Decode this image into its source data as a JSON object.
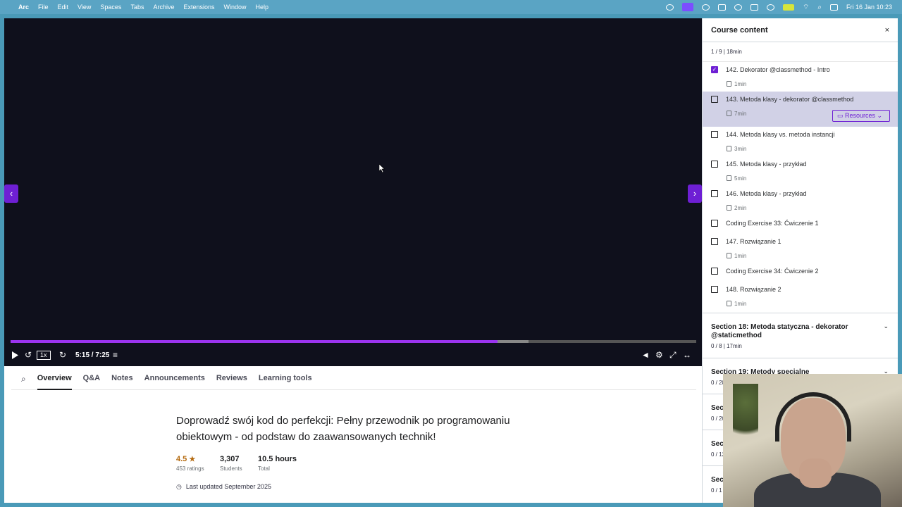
{
  "menubar": {
    "items": [
      "Arc",
      "File",
      "Edit",
      "View",
      "Spaces",
      "Tabs",
      "Archive",
      "Extensions",
      "Window",
      "Help"
    ],
    "clock": "Fri 16 Jan  10:23"
  },
  "player": {
    "speed": "1x",
    "time": "5:15 / 7:25",
    "progress": 0.71,
    "buffered": 0.755,
    "accent": "#9b34ef"
  },
  "tabs": [
    "Overview",
    "Q&A",
    "Notes",
    "Announcements",
    "Reviews",
    "Learning tools"
  ],
  "overview": {
    "title": "Doprowadź swój kod do perfekcji: Pełny przewodnik po programowaniu obiektowym - od podstaw do zaawansowanych technik!",
    "rating": "4.5",
    "ratings_label": "453 ratings",
    "students": "3,307",
    "students_label": "Students",
    "hours": "10.5 hours",
    "hours_label": "Total",
    "updated": "Last updated September 2025"
  },
  "panel": {
    "title": "Course content",
    "close": "×",
    "section_meta": "1 / 9 | 18min",
    "lectures": [
      {
        "title": "142. Dekorator @classmethod - Intro",
        "duration": "1min",
        "checked": true
      },
      {
        "title": "143. Metoda klasy - dekorator @classmethod",
        "duration": "7min",
        "checked": false,
        "current": true,
        "resources": "Resources"
      },
      {
        "title": "144. Metoda klasy vs. metoda instancji",
        "duration": "3min",
        "checked": false
      },
      {
        "title": "145. Metoda klasy - przykład",
        "duration": "5min",
        "checked": false
      },
      {
        "title": "146. Metoda klasy - przykład",
        "duration": "2min",
        "checked": false
      },
      {
        "title": "Coding Exercise 33: Ćwiczenie 1",
        "duration": "",
        "checked": false
      },
      {
        "title": "147. Rozwiązanie 1",
        "duration": "1min",
        "checked": false
      },
      {
        "title": "Coding Exercise 34: Ćwiczenie 2",
        "duration": "",
        "checked": false
      },
      {
        "title": "148. Rozwiązanie 2",
        "duration": "1min",
        "checked": false
      }
    ],
    "sections": [
      {
        "title": "Section 18: Metoda statyczna - dekorator @staticmethod",
        "meta": "0 / 8 | 17min"
      },
      {
        "title": "Section 19: Metody specjalne",
        "meta": "0 / 28"
      },
      {
        "title": "Secti",
        "meta": "0 / 20"
      },
      {
        "title": "Secti",
        "meta": "0 / 12"
      },
      {
        "title": "Secti",
        "meta": "0 / 1"
      }
    ]
  }
}
